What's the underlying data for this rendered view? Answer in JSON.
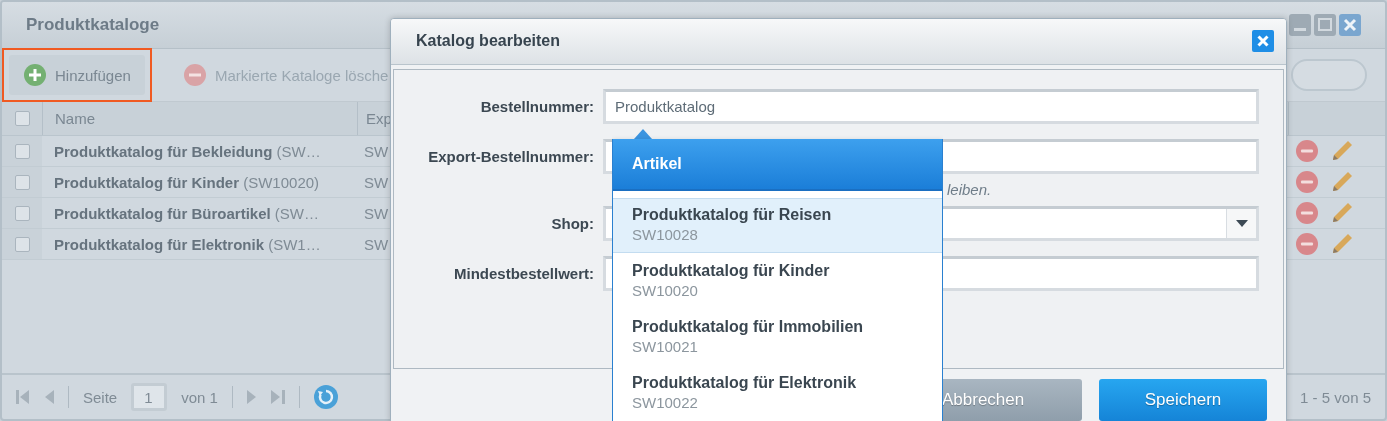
{
  "window": {
    "title": "Produktkataloge"
  },
  "toolbar": {
    "buttons": [
      {
        "label": "Hinzufügen",
        "kind": "add",
        "disabled": false,
        "highlighted": true
      },
      {
        "label": "Markierte Kataloge lösche",
        "kind": "delete",
        "disabled": true,
        "highlighted": false
      }
    ]
  },
  "grid": {
    "columns": [
      "Name",
      "Exp"
    ],
    "all_checked": false,
    "rows": [
      {
        "name": "**Produktkatalog für Bekleidung** (SW…",
        "column_2": "SW",
        "checked": false
      },
      {
        "name": "**Produktkatalog für Kinder** (SW10020)",
        "column_2": "SW",
        "checked": false
      },
      {
        "name": "**Produktkatalog für Büroartikel** (SW…",
        "column_2": "SW",
        "checked": false
      },
      {
        "name": "**Produktkatalog für Elektronik** (SW1…",
        "column_2": "SW",
        "checked": false
      }
    ]
  },
  "pager": {
    "page_label": "Seite",
    "page": "1",
    "of": "von 1",
    "summary": "1 - 5 von 5"
  },
  "dialog": {
    "title": "Katalog bearbeiten",
    "fields": [
      {
        "label": "Bestellnummer:",
        "kind": "text",
        "value": "Produktkatalog"
      },
      {
        "label": "Export-Bestellnummer:",
        "kind": "text",
        "help": "leiben."
      },
      {
        "label": "Shop:",
        "kind": "combo"
      },
      {
        "label": "Mindestbestellwert:",
        "kind": "text"
      }
    ],
    "buttons": [
      {
        "label": "Abbrechen",
        "kind": "secondary"
      },
      {
        "label": "Speichern",
        "kind": "primary"
      }
    ]
  },
  "dropdown": {
    "header": "Artikel",
    "items": [
      {
        "title": "Produktkatalog für Reisen",
        "number": "SW10028",
        "selected": true
      },
      {
        "title": "Produktkatalog für Kinder",
        "number": "SW10020",
        "selected": false
      },
      {
        "title": "Produktkatalog für Immobilien",
        "number": "SW10021",
        "selected": false
      },
      {
        "title": "Produktkatalog für Elektronik",
        "number": "SW10022",
        "selected": false
      }
    ]
  }
}
